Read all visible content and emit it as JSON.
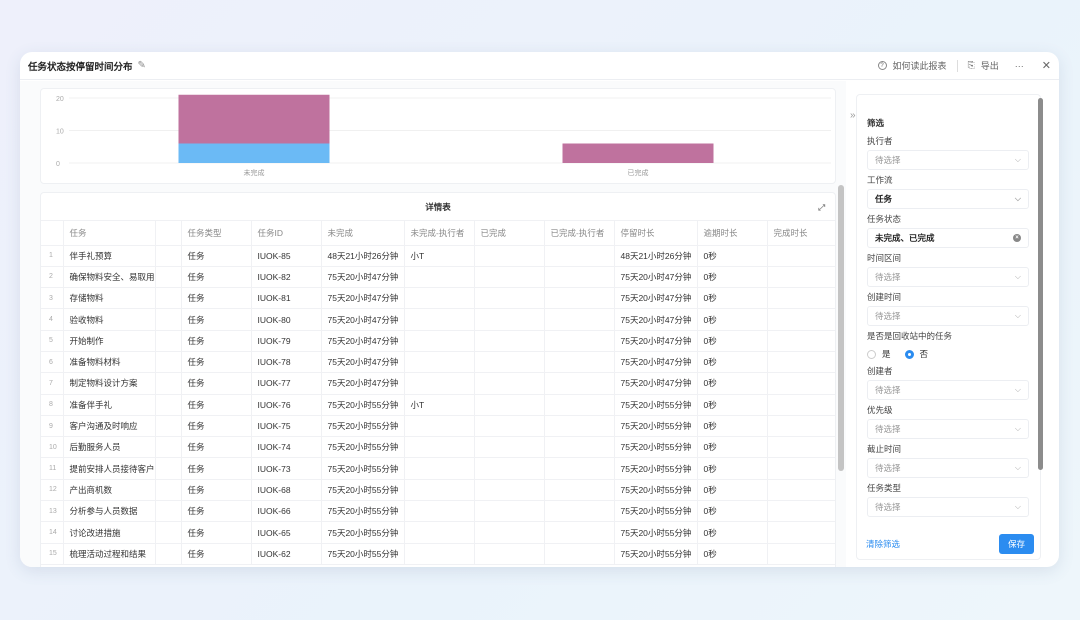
{
  "header": {
    "title": "任务状态按停留时间分布",
    "help": "如何读此报表",
    "export": "导出",
    "more": "···",
    "close": "✕"
  },
  "chart_data": {
    "type": "bar",
    "stacked": true,
    "categories": [
      "未完成",
      "已完成"
    ],
    "series": [
      {
        "color": "#6bbaf5",
        "values": [
          6,
          0
        ]
      },
      {
        "color": "#bf729e",
        "values": [
          15,
          6
        ]
      }
    ],
    "yticks": [
      0,
      10,
      20
    ],
    "ylim": [
      0,
      21
    ],
    "grid": true
  },
  "table": {
    "title": "详情表",
    "columns": [
      "任务",
      "",
      "任务类型",
      "任务ID",
      "未完成",
      "未完成-执行者",
      "已完成",
      "已完成-执行者",
      "停留时长",
      "逾期时长",
      "完成时长"
    ],
    "rows": [
      [
        "1",
        "伴手礼预算",
        "",
        "任务",
        "IUOK-85",
        "48天21小时26分钟",
        "小T",
        "",
        "",
        "48天21小时26分钟",
        "0秒",
        ""
      ],
      [
        "2",
        "确保物料安全、易取用",
        "",
        "任务",
        "IUOK-82",
        "75天20小时47分钟",
        "",
        "",
        "",
        "75天20小时47分钟",
        "0秒",
        ""
      ],
      [
        "3",
        "存储物料",
        "",
        "任务",
        "IUOK-81",
        "75天20小时47分钟",
        "",
        "",
        "",
        "75天20小时47分钟",
        "0秒",
        ""
      ],
      [
        "4",
        "验收物料",
        "",
        "任务",
        "IUOK-80",
        "75天20小时47分钟",
        "",
        "",
        "",
        "75天20小时47分钟",
        "0秒",
        ""
      ],
      [
        "5",
        "开始制作",
        "",
        "任务",
        "IUOK-79",
        "75天20小时47分钟",
        "",
        "",
        "",
        "75天20小时47分钟",
        "0秒",
        ""
      ],
      [
        "6",
        "准备物料材料",
        "",
        "任务",
        "IUOK-78",
        "75天20小时47分钟",
        "",
        "",
        "",
        "75天20小时47分钟",
        "0秒",
        ""
      ],
      [
        "7",
        "制定物料设计方案",
        "",
        "任务",
        "IUOK-77",
        "75天20小时47分钟",
        "",
        "",
        "",
        "75天20小时47分钟",
        "0秒",
        ""
      ],
      [
        "8",
        "准备伴手礼",
        "",
        "任务",
        "IUOK-76",
        "75天20小时55分钟",
        "小T",
        "",
        "",
        "75天20小时55分钟",
        "0秒",
        ""
      ],
      [
        "9",
        "客户沟通及时响应",
        "",
        "任务",
        "IUOK-75",
        "75天20小时55分钟",
        "",
        "",
        "",
        "75天20小时55分钟",
        "0秒",
        ""
      ],
      [
        "10",
        "后勤服务人员",
        "",
        "任务",
        "IUOK-74",
        "75天20小时55分钟",
        "",
        "",
        "",
        "75天20小时55分钟",
        "0秒",
        ""
      ],
      [
        "11",
        "提前安排人员接待客户",
        "",
        "任务",
        "IUOK-73",
        "75天20小时55分钟",
        "",
        "",
        "",
        "75天20小时55分钟",
        "0秒",
        ""
      ],
      [
        "12",
        "产出商机数",
        "",
        "任务",
        "IUOK-68",
        "75天20小时55分钟",
        "",
        "",
        "",
        "75天20小时55分钟",
        "0秒",
        ""
      ],
      [
        "13",
        "分析参与人员数据",
        "",
        "任务",
        "IUOK-66",
        "75天20小时55分钟",
        "",
        "",
        "",
        "75天20小时55分钟",
        "0秒",
        ""
      ],
      [
        "14",
        "讨论改进措施",
        "",
        "任务",
        "IUOK-65",
        "75天20小时55分钟",
        "",
        "",
        "",
        "75天20小时55分钟",
        "0秒",
        ""
      ],
      [
        "15",
        "梳理活动过程和结果",
        "",
        "任务",
        "IUOK-62",
        "75天20小时55分钟",
        "",
        "",
        "",
        "75天20小时55分钟",
        "0秒",
        ""
      ]
    ]
  },
  "filter": {
    "title": "筛选",
    "fields": [
      {
        "label": "执行者",
        "value": "待选择",
        "filled": false
      },
      {
        "label": "工作流",
        "value": "任务",
        "filled": true
      },
      {
        "label": "任务状态",
        "value": "未完成、已完成",
        "filled": true,
        "clearable": true
      },
      {
        "label": "时间区间",
        "value": "待选择",
        "filled": false
      },
      {
        "label": "创建时间",
        "value": "待选择",
        "filled": false
      }
    ],
    "recycle": {
      "label": "是否是回收站中的任务",
      "options": [
        "是",
        "否"
      ],
      "selected": "否"
    },
    "fields2": [
      {
        "label": "创建者",
        "value": "待选择"
      },
      {
        "label": "优先级",
        "value": "待选择"
      },
      {
        "label": "截止时间",
        "value": "待选择"
      },
      {
        "label": "任务类型",
        "value": "待选择"
      }
    ],
    "clear": "清除筛选",
    "save": "保存"
  }
}
